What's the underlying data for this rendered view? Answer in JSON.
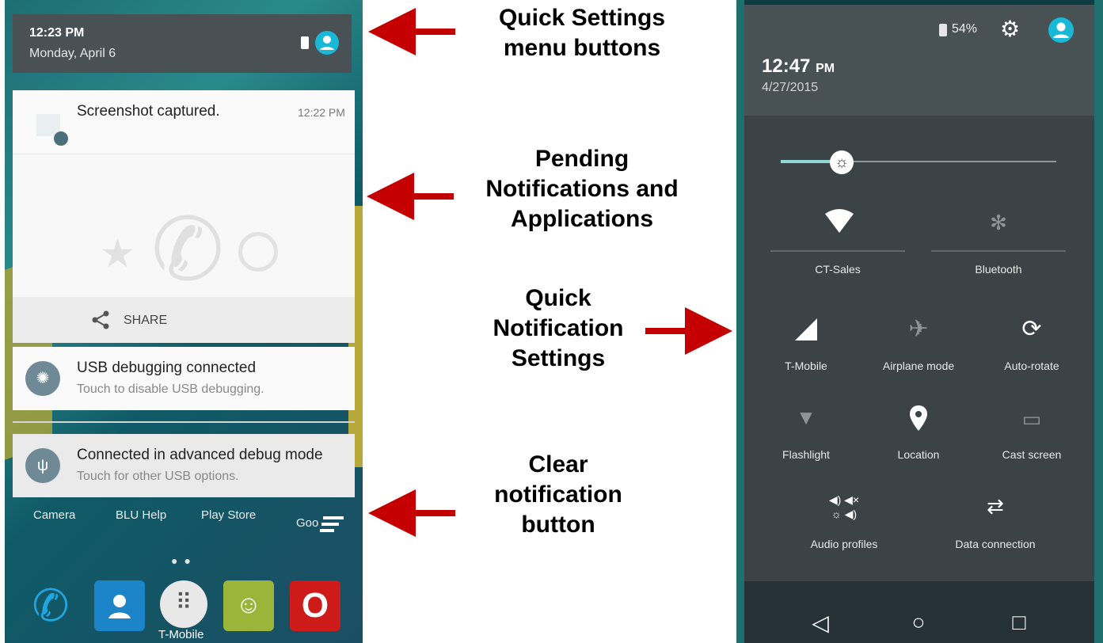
{
  "left_phone": {
    "status": {
      "time": "12:23 PM",
      "date": "Monday, April 6"
    },
    "notifications": [
      {
        "title": "Screenshot captured.",
        "time": "12:22 PM"
      },
      {
        "title": "USB debugging connected",
        "subtitle": "Touch to disable USB debugging."
      },
      {
        "title": "Connected in advanced debug mode",
        "subtitle": "Touch for other USB options."
      }
    ],
    "share_label": "SHARE",
    "apps_row": [
      "Camera",
      "BLU Help",
      "Play Store",
      "Goo"
    ],
    "dock_label": "T-Mobile",
    "icons": {
      "battery": "battery-icon",
      "avatar": "avatar-icon",
      "share": "share-icon",
      "android": "android-debug-icon",
      "usb": "usb-icon",
      "clear": "clear-all-icon"
    }
  },
  "captions": {
    "quick_settings": "Quick Settings menu buttons",
    "pending": "Pending Notifications and Applications",
    "quick_notification": "Quick Notification Settings",
    "clear": "Clear notification button"
  },
  "right_phone": {
    "header": {
      "battery": "54%",
      "time": "12:47",
      "ampm": "PM",
      "date": "4/27/2015"
    },
    "tiles": {
      "wifi": "CT-Sales",
      "bluetooth": "Bluetooth",
      "mobile": "T-Mobile",
      "airplane": "Airplane mode",
      "rotate": "Auto-rotate",
      "flashlight": "Flashlight",
      "location": "Location",
      "cast": "Cast screen",
      "audio": "Audio profiles",
      "data": "Data connection"
    },
    "brightness_level": 0.22,
    "nav": {
      "back": "◁",
      "home": "○",
      "recents": "□"
    }
  },
  "colors": {
    "arrow": "#c40000",
    "accent": "#19b8d6"
  }
}
